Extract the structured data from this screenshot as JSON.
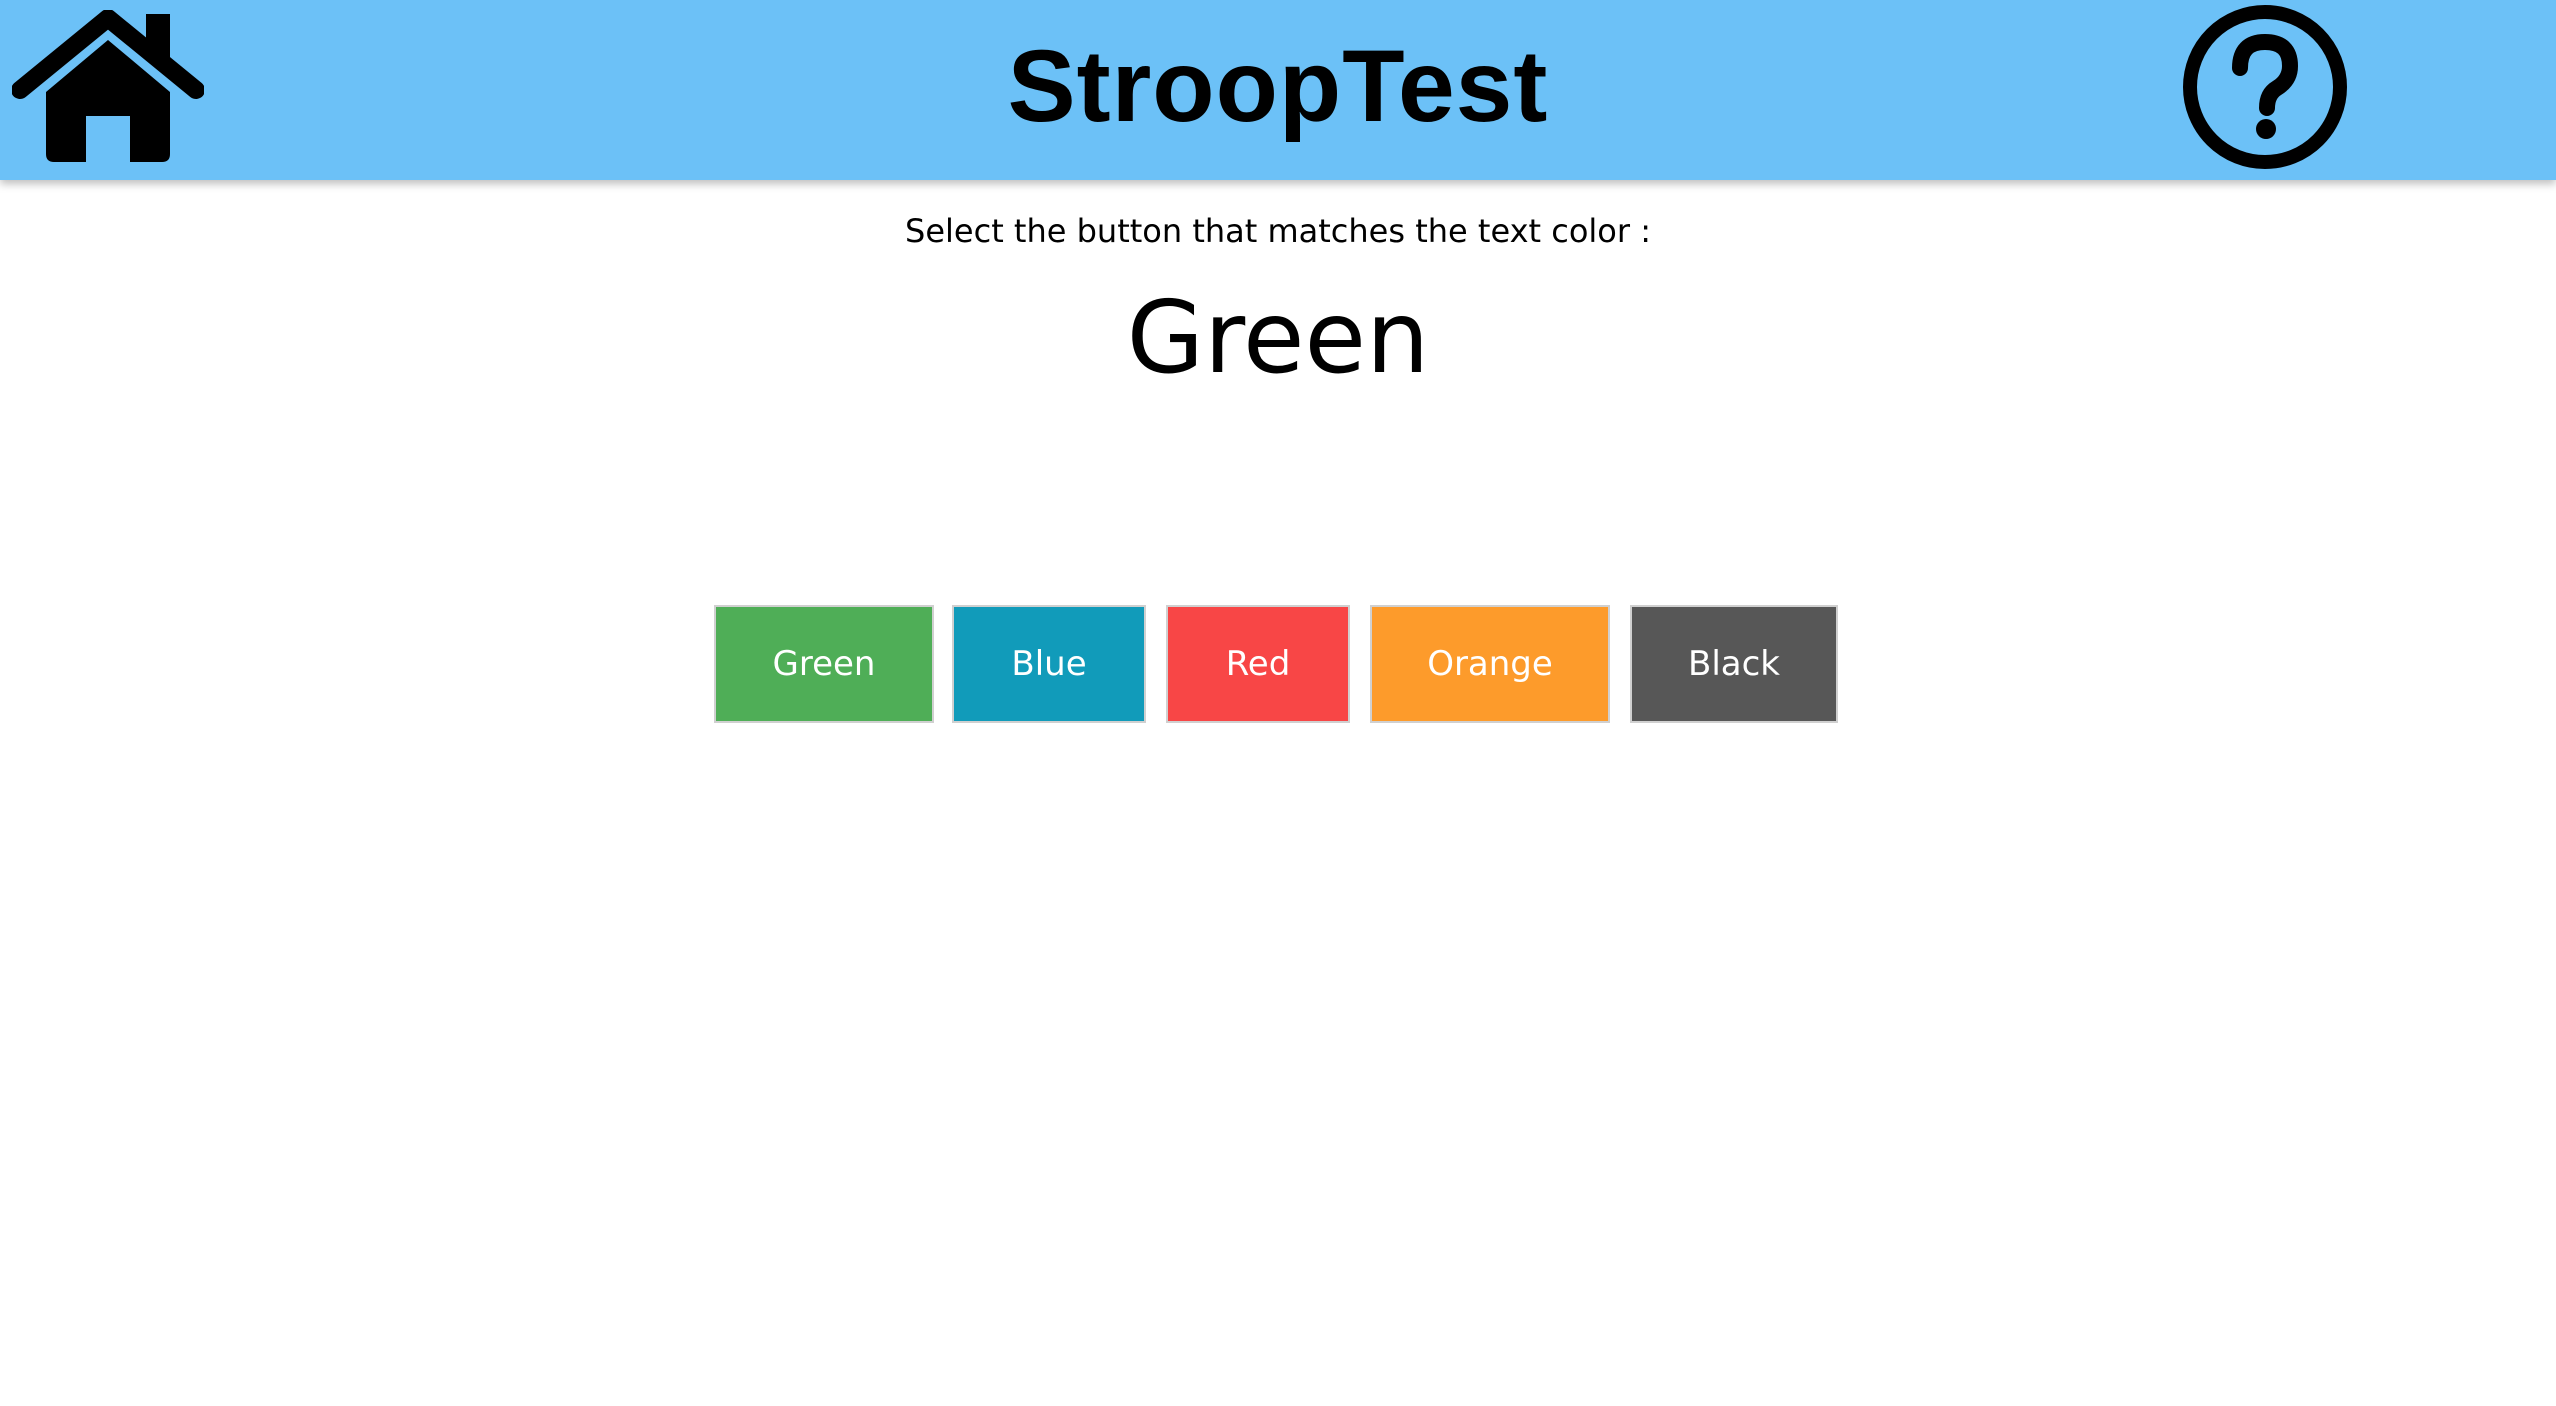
{
  "header": {
    "title": "StroopTest",
    "background_color": "#6cc1f7",
    "home_icon": "home-icon",
    "help_icon": "question-circle-icon"
  },
  "main": {
    "instruction": "Select the button that matches the text color :",
    "stimulus_word": "Green",
    "stimulus_color": "#000000"
  },
  "choices": [
    {
      "label": "Green",
      "color": "#4fae57"
    },
    {
      "label": "Blue",
      "color": "#119bba"
    },
    {
      "label": "Red",
      "color": "#f84646"
    },
    {
      "label": "Orange",
      "color": "#fd9b2b"
    },
    {
      "label": "Black",
      "color": "#575757"
    }
  ]
}
